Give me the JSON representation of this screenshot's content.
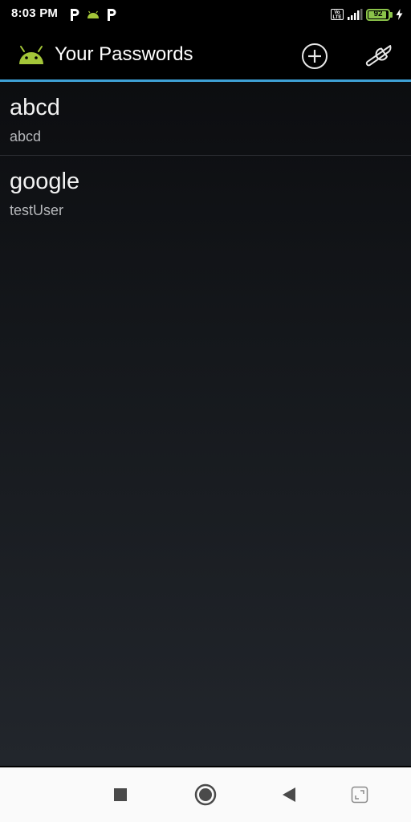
{
  "status_bar": {
    "time": "8:03 PM",
    "left_icons": [
      "p-icon",
      "android-icon",
      "p-icon"
    ],
    "right_icons": [
      "volte-icon",
      "signal-icon",
      "battery-icon",
      "charging-icon"
    ],
    "volte_label": "Vo LTE",
    "battery_percent": "92",
    "battery_level": 0.92
  },
  "action_bar": {
    "app_icon": "android-icon",
    "title": "Your Passwords",
    "actions": [
      "add-icon",
      "wrench-icon"
    ]
  },
  "passwords": [
    {
      "title": "abcd",
      "subtitle": "abcd"
    },
    {
      "title": "google",
      "subtitle": "testUser"
    }
  ],
  "nav_bar": {
    "buttons": [
      "recents-icon",
      "home-icon",
      "back-icon",
      "screenshot-icon"
    ]
  },
  "colors": {
    "accent": "#3ea0d6",
    "android_green": "#a4c639",
    "battery_green": "#8bc34a",
    "background": "#000000"
  }
}
